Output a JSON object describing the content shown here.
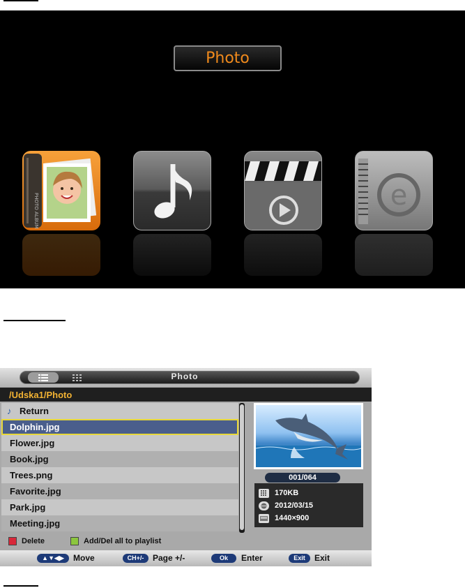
{
  "menu": {
    "title": "Photo",
    "tiles": [
      {
        "name": "Photo",
        "icon": "photo-album-icon"
      },
      {
        "name": "Music",
        "icon": "music-note-icon"
      },
      {
        "name": "Movie",
        "icon": "clapperboard-icon"
      },
      {
        "name": "E-book",
        "icon": "ebook-icon"
      }
    ],
    "colors": {
      "title_text": "#f08a1c",
      "selected_tile": "#f08a1c"
    }
  },
  "browser": {
    "title": "Photo",
    "path": "/Udska1/Photo",
    "return_label": "Return",
    "files": [
      {
        "name": "Dolphin.jpg",
        "selected": true
      },
      {
        "name": "Flower.jpg"
      },
      {
        "name": "Book.jpg"
      },
      {
        "name": "Trees.png"
      },
      {
        "name": "Favorite.jpg"
      },
      {
        "name": "Park.jpg"
      },
      {
        "name": "Meeting.jpg"
      }
    ],
    "counter": "001/064",
    "info": {
      "size": "170KB",
      "date": "2012/03/15",
      "resolution": "1440×900"
    },
    "legend": {
      "red_label": "Delete",
      "green_label": "Add/Del all to playlist"
    },
    "hints": [
      {
        "key": "▲▼◀▶",
        "label": "Move"
      },
      {
        "key": "CH+/-",
        "label": "Page +/-"
      },
      {
        "key": "Ok",
        "label": "Enter"
      },
      {
        "key": "Exit",
        "label": "Exit"
      }
    ],
    "colors": {
      "path_text": "#f2b233",
      "selection_border": "#e8d83a",
      "red": "#d8283a",
      "green": "#8cc63e"
    }
  }
}
